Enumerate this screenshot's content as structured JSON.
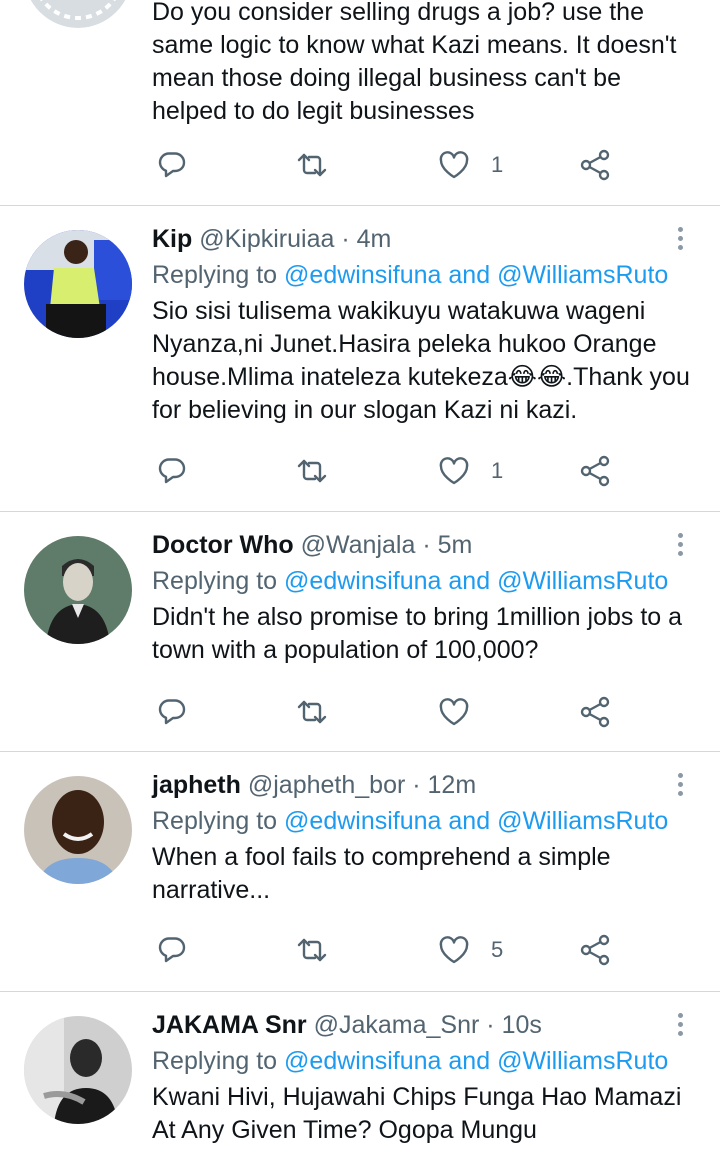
{
  "colors": {
    "link": "#1d9bf0",
    "muted": "#536471",
    "text": "#0f1419",
    "divider": "#cfd9de"
  },
  "icons": {
    "reply": "reply-icon",
    "retweet": "retweet-icon",
    "like": "heart-icon",
    "share": "share-icon",
    "more": "more-icon"
  },
  "first": {
    "body": "Do you consider selling drugs a job?  use the same logic to know what Kazi means. It doesn't mean those doing illegal business can't be helped to do legit businesses",
    "likes": "1"
  },
  "tweets": [
    {
      "name": "Kip",
      "handle": "@Kipkiruiaa",
      "dot": "·",
      "time": "4m",
      "replying": "Replying to",
      "mention1": "@edwinsifuna",
      "and": "and",
      "mention2": "@WilliamsRuto",
      "body": "Sio sisi tulisema wakikuyu watakuwa wageni Nyanza,ni Junet.Hasira peleka hukoo Orange house.Mlima inateleza kutekeza😂😂.Thank you for believing in our slogan Kazi ni kazi.",
      "likes": "1"
    },
    {
      "name": "Doctor Who",
      "handle": "@Wanjala",
      "dot": "·",
      "time": "5m",
      "replying": "Replying to",
      "mention1": "@edwinsifuna",
      "and": "and",
      "mention2": "@WilliamsRuto",
      "body": "Didn't he also promise to bring 1million jobs to a town with a population of 100,000?",
      "likes": ""
    },
    {
      "name": "japheth",
      "handle": "@japheth_bor",
      "dot": "·",
      "time": "12m",
      "replying": "Replying to",
      "mention1": "@edwinsifuna",
      "and": "and",
      "mention2": "@WilliamsRuto",
      "body": "When a fool fails to comprehend a simple narrative...",
      "likes": "5"
    },
    {
      "name": "JAKAMA Snr",
      "handle": "@Jakama_Snr",
      "dot": "·",
      "time": "10s",
      "replying": "Replying to",
      "mention1": "@edwinsifuna",
      "and": "and",
      "mention2": "@WilliamsRuto",
      "body": "Kwani Hivi, Hujawahi Chips Funga Hao Mamazi At Any Given Time? Ogopa Mungu",
      "likes": ""
    }
  ]
}
